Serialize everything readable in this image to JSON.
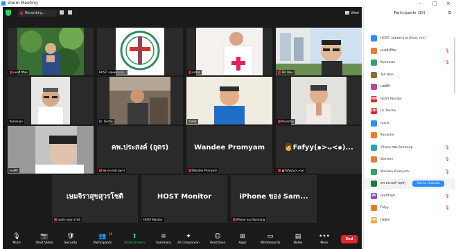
{
  "window": {
    "title": "Zoom Meeting",
    "controls": {
      "minimize": "–",
      "maximize": "□",
      "close": "×"
    }
  },
  "meeting": {
    "recording_label": "Recording...",
    "view_label": "View",
    "tiles": [
      {
        "name": "แมลสี สิริพง",
        "video": "garden-man",
        "muted": true,
        "big_name": ""
      },
      {
        "name": "HOST: กลุ่มพยาบาล...",
        "video": "logo",
        "muted": false,
        "big_name": ""
      },
      {
        "name": "กลอ๊อก",
        "video": "priest",
        "muted": true,
        "big_name": ""
      },
      {
        "name": "Toh Wee",
        "video": "man-glasses",
        "muted": true,
        "big_name": ""
      },
      {
        "name": "Kumnuan",
        "video": "older-man-glasses",
        "muted": false,
        "big_name": ""
      },
      {
        "name": "Dr. Decha",
        "video": "seated-man",
        "muted": false,
        "big_name": ""
      },
      {
        "name": "manit",
        "video": "man-blue",
        "muted": false,
        "big_name": ""
      },
      {
        "name": "Kanantai",
        "video": "woman-praying",
        "muted": true,
        "big_name": ""
      },
      {
        "name": "พงษ์ศิริ",
        "video": "woman-closeup",
        "muted": false,
        "big_name": ""
      },
      {
        "name": "พพ.ประสงค์ (อุดร)",
        "video": "",
        "muted": true,
        "big_name": "คพ.ประสงค์ (อุดร)"
      },
      {
        "name": "Wandee Promyam",
        "video": "",
        "muted": true,
        "big_name": "Wandee Promyam"
      },
      {
        "name": "👩Fafyy(๑>ᴗ<๑)",
        "video": "",
        "muted": true,
        "big_name": "👩Fafyy(๑>ᴗ<๑)..."
      },
      {
        "name": "เษมจิราสุขสุวรโชติ",
        "video": "",
        "muted": true,
        "big_name": "เษมจิราสุขสุวรโชติ"
      },
      {
        "name": "HOST Monitor",
        "video": "",
        "muted": false,
        "big_name": "HOST Monitor"
      },
      {
        "name": "iPhone ของ Somrang",
        "video": "",
        "muted": true,
        "big_name": "iPhone ของ Sam..."
      }
    ]
  },
  "controls": [
    {
      "label": "Mute",
      "icon": "mic-icon",
      "glyph": "🎙"
    },
    {
      "label": "Start Video",
      "icon": "video-off-icon",
      "glyph": "📷"
    },
    {
      "label": "Security",
      "icon": "shield-icon",
      "glyph": "🛡"
    },
    {
      "label": "Participants",
      "icon": "participants-icon",
      "glyph": "👥",
      "count": "15"
    },
    {
      "label": "Share Screen",
      "icon": "share-screen-icon",
      "glyph": "⬆"
    },
    {
      "label": "Summary",
      "icon": "summary-icon",
      "glyph": "≡"
    },
    {
      "label": "AI Companion",
      "icon": "ai-companion-icon",
      "glyph": "✦"
    },
    {
      "label": "Reactions",
      "icon": "reactions-icon",
      "glyph": "☺"
    },
    {
      "label": "Apps",
      "icon": "apps-icon",
      "glyph": "⊞"
    },
    {
      "label": "Whiteboards",
      "icon": "whiteboard-icon",
      "glyph": "▭"
    },
    {
      "label": "Notes",
      "icon": "notes-icon",
      "glyph": "▤"
    },
    {
      "label": "More",
      "icon": "more-icon",
      "glyph": "•••"
    }
  ],
  "end_label": "End",
  "participants_panel": {
    "title": "Participants (15)",
    "items": [
      {
        "name": "HOST: กลุ่มพยาบาล (Host, me)",
        "initials": "",
        "color": "#2d8cff",
        "icons": ""
      },
      {
        "name": "แมลสี สิริพง",
        "initials": "",
        "color": "#e87b2e",
        "icons": "🎙"
      },
      {
        "name": "Kumnuan",
        "initials": "",
        "color": "#2fa36b",
        "icons": "🎙"
      },
      {
        "name": "Toh Wee",
        "initials": "",
        "color": "#8a6d3b",
        "icons": ""
      },
      {
        "name": "พงษ์ศิริ",
        "initials": "",
        "color": "#b84a9b",
        "icons": ""
      },
      {
        "name": "HOST Monitor",
        "initials": "HM",
        "color": "#e02828",
        "icons": ""
      },
      {
        "name": "Dr. Decha",
        "initials": "DD",
        "color": "#e02828",
        "icons": ""
      },
      {
        "name": "manit",
        "initials": "",
        "color": "#2d8cff",
        "icons": ""
      },
      {
        "name": "Kanantai",
        "initials": "",
        "color": "#e87b2e",
        "icons": ""
      },
      {
        "name": "iPhone ของ Somrang",
        "initials": "",
        "color": "#23a3b8",
        "icons": "🎙"
      },
      {
        "name": "Wandee",
        "initials": "",
        "color": "#e87b2e",
        "icons": "🎙"
      },
      {
        "name": "Wandee Promyam",
        "initials": "",
        "color": "#2fa36b",
        "icons": "🎙"
      },
      {
        "name": "คพ.ประสงค์ (อุดร)",
        "initials": "",
        "color": "#1f7a3e",
        "icons": "",
        "action": "Ask to Unmute"
      },
      {
        "name": "เษมจิราสุข",
        "initials": "M",
        "color": "#8b4fc4",
        "icons": "🎙"
      },
      {
        "name": "Fafyy",
        "initials": "",
        "color": "#e87b2e",
        "icons": "🎙"
      },
      {
        "name": "กลอ๊อก",
        "initials": "HH",
        "color": "#f2a23a",
        "icons": ""
      }
    ]
  }
}
